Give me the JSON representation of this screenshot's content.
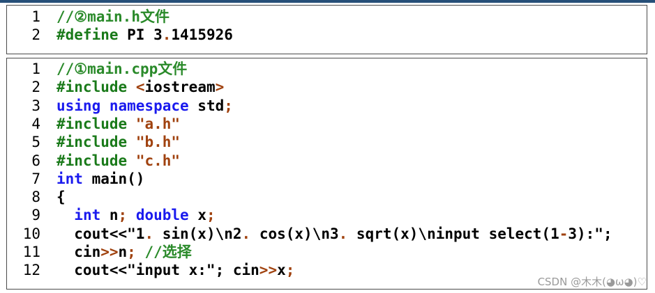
{
  "colors": {
    "comment": "#2a8a2a",
    "keyword": "#1a1aee",
    "preprocessor": "#1a7a1a",
    "operator": "#a0420f",
    "plain": "#000000"
  },
  "panel1": {
    "lines": [
      {
        "num": "1",
        "t": [
          {
            "c": "cm",
            "v": "//②main.h文件"
          }
        ]
      },
      {
        "num": "2",
        "t": [
          {
            "c": "pp",
            "v": "#define"
          },
          {
            "c": "plain",
            "v": " PI 3"
          },
          {
            "c": "op",
            "v": "."
          },
          {
            "c": "plain",
            "v": "1415926"
          }
        ]
      }
    ]
  },
  "panel2": {
    "lines": [
      {
        "num": "1",
        "t": [
          {
            "c": "cm",
            "v": "//①main.cpp文件"
          }
        ]
      },
      {
        "num": "2",
        "t": [
          {
            "c": "pp",
            "v": "#include"
          },
          {
            "c": "plain",
            "v": " "
          },
          {
            "c": "op",
            "v": "<"
          },
          {
            "c": "plain",
            "v": "iostream"
          },
          {
            "c": "op",
            "v": ">"
          }
        ]
      },
      {
        "num": "3",
        "t": [
          {
            "c": "kw",
            "v": "using namespace"
          },
          {
            "c": "plain",
            "v": " std"
          },
          {
            "c": "op",
            "v": ";"
          }
        ]
      },
      {
        "num": "4",
        "t": [
          {
            "c": "pp",
            "v": "#include"
          },
          {
            "c": "plain",
            "v": " "
          },
          {
            "c": "str",
            "v": "\"a.h\""
          }
        ]
      },
      {
        "num": "5",
        "t": [
          {
            "c": "pp",
            "v": "#include"
          },
          {
            "c": "plain",
            "v": " "
          },
          {
            "c": "str",
            "v": "\"b.h\""
          }
        ]
      },
      {
        "num": "6",
        "t": [
          {
            "c": "pp",
            "v": "#include"
          },
          {
            "c": "plain",
            "v": " "
          },
          {
            "c": "str",
            "v": "\"c.h\""
          }
        ]
      },
      {
        "num": "7",
        "t": [
          {
            "c": "kw",
            "v": "int"
          },
          {
            "c": "plain",
            "v": " main()"
          }
        ]
      },
      {
        "num": "8",
        "t": [
          {
            "c": "plain",
            "v": "{"
          }
        ]
      },
      {
        "num": "9",
        "t": [
          {
            "c": "plain",
            "v": "  "
          },
          {
            "c": "kw",
            "v": "int"
          },
          {
            "c": "plain",
            "v": " n"
          },
          {
            "c": "op",
            "v": ";"
          },
          {
            "c": "plain",
            "v": " "
          },
          {
            "c": "kw",
            "v": "double"
          },
          {
            "c": "plain",
            "v": " x"
          },
          {
            "c": "op",
            "v": ";"
          }
        ]
      },
      {
        "num": "10",
        "t": [
          {
            "c": "plain",
            "v": "  cout<<\"1"
          },
          {
            "c": "op",
            "v": "."
          },
          {
            "c": "plain",
            "v": " sin(x)\\n2"
          },
          {
            "c": "op",
            "v": "."
          },
          {
            "c": "plain",
            "v": " cos(x)\\n3"
          },
          {
            "c": "op",
            "v": "."
          },
          {
            "c": "plain",
            "v": " sqrt(x)\\ninput select(1"
          },
          {
            "c": "op",
            "v": "-"
          },
          {
            "c": "plain",
            "v": "3):\";"
          }
        ]
      },
      {
        "num": "11",
        "t": [
          {
            "c": "plain",
            "v": "  cin"
          },
          {
            "c": "op",
            "v": ">>"
          },
          {
            "c": "plain",
            "v": "n"
          },
          {
            "c": "op",
            "v": ";"
          },
          {
            "c": "plain",
            "v": " "
          },
          {
            "c": "cm",
            "v": "//选择"
          }
        ]
      },
      {
        "num": "12",
        "t": [
          {
            "c": "plain",
            "v": "  cout<<\"input x:\"; cin"
          },
          {
            "c": "op",
            "v": ">>"
          },
          {
            "c": "plain",
            "v": "x"
          },
          {
            "c": "op",
            "v": ";"
          }
        ]
      }
    ]
  },
  "watermark": "CSDN @木木(◕ω◕)♡"
}
